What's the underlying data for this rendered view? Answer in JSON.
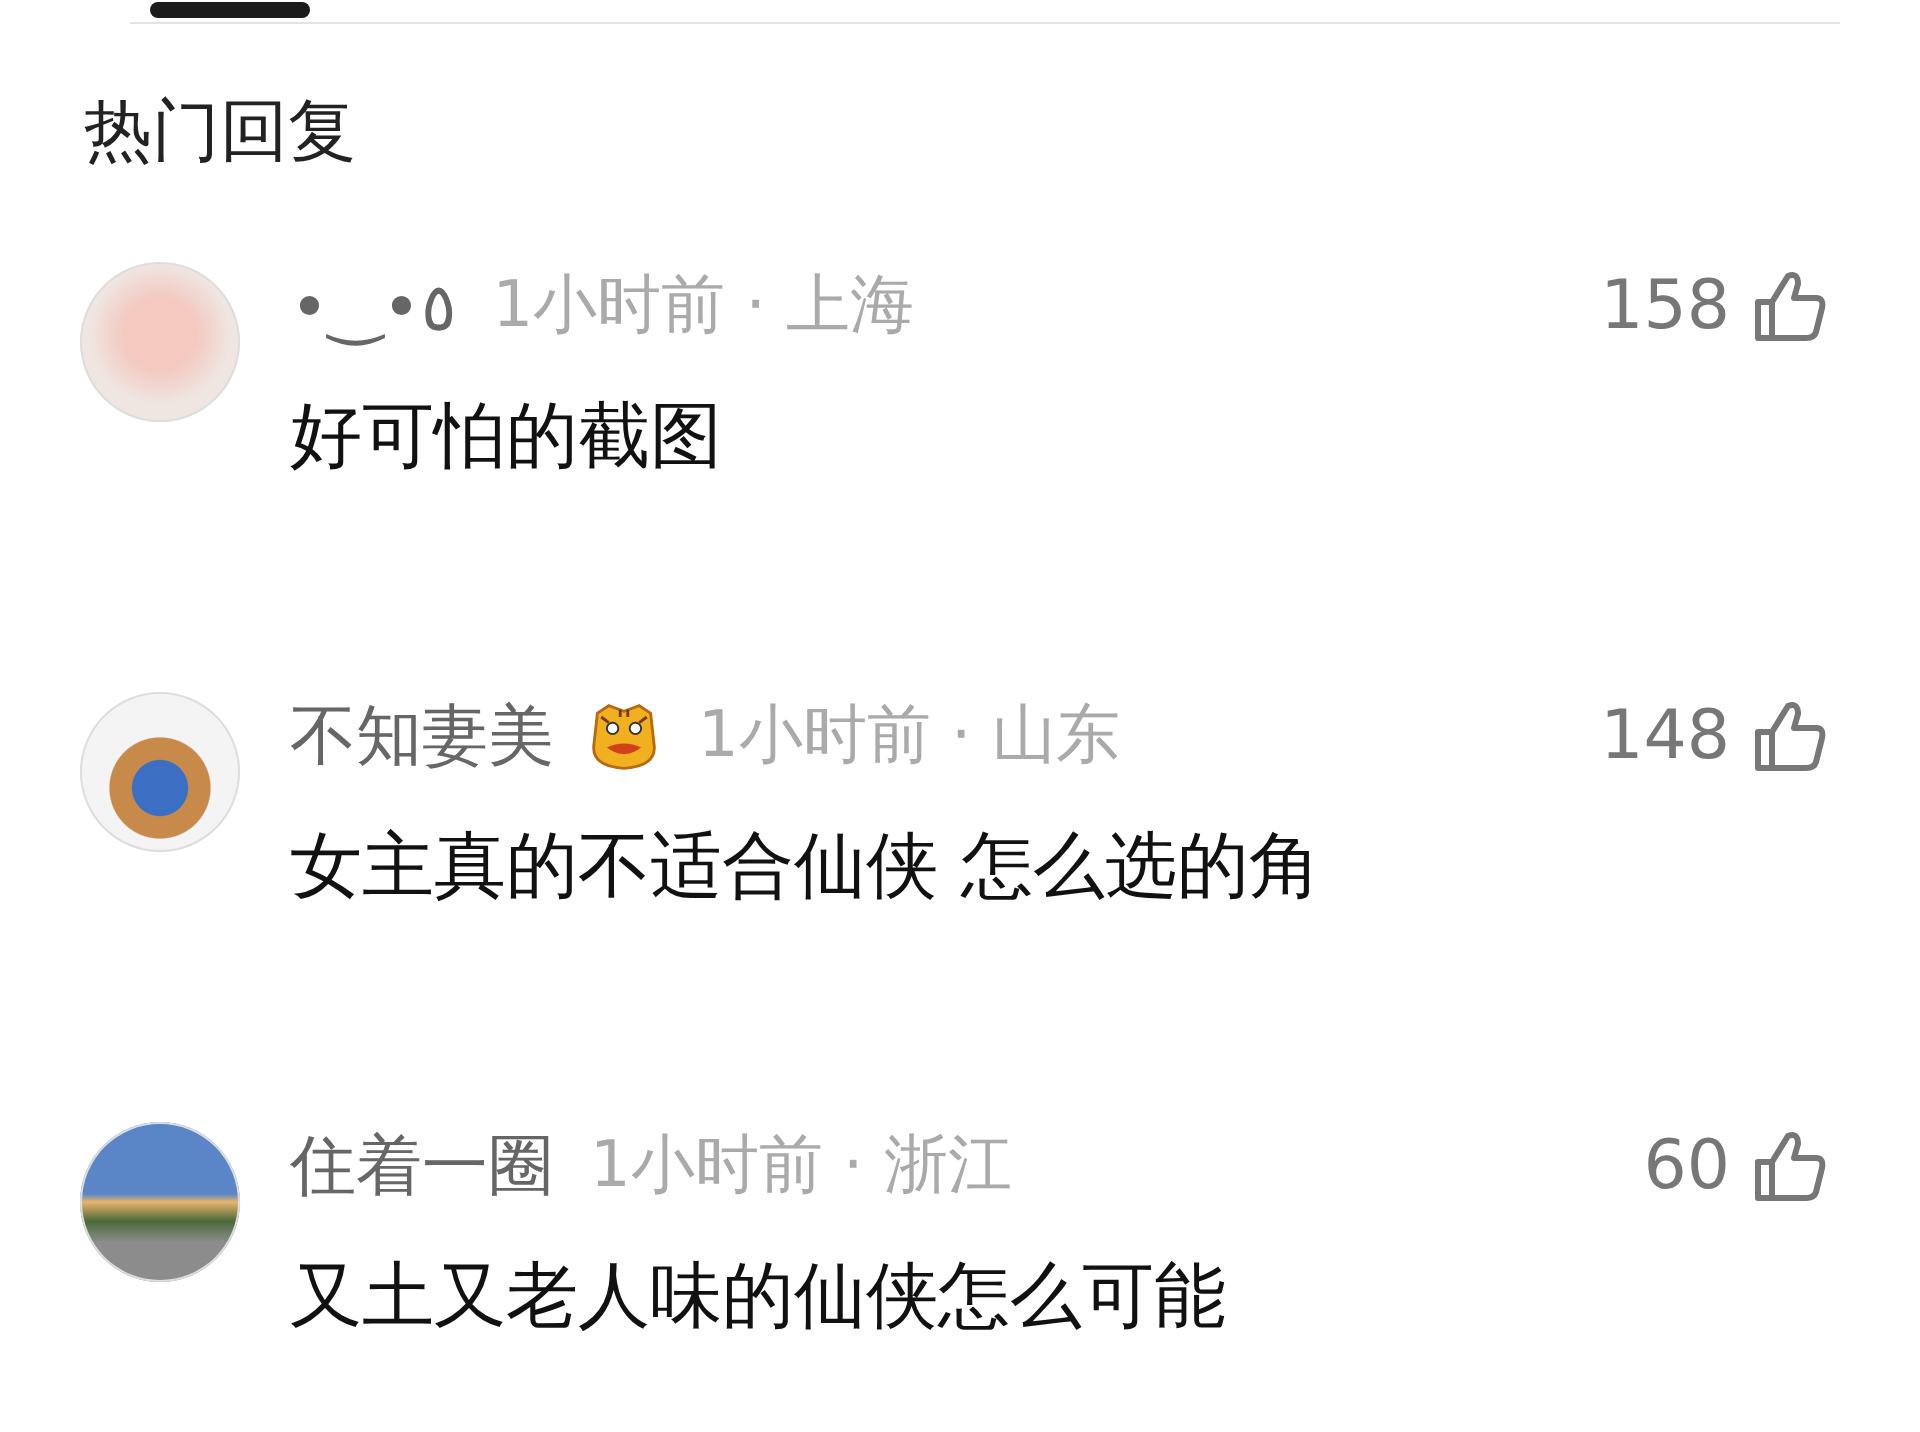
{
  "section_title": "热门回复",
  "comments": [
    {
      "name": "•‿•٥",
      "badge": false,
      "meta": "1小时前 · 上海",
      "likes": "158",
      "text": "好可怕的截图"
    },
    {
      "name": "不知妻美",
      "badge": true,
      "meta": "1小时前 · 山东",
      "likes": "148",
      "text": "女主真的不适合仙侠 怎么选的角"
    },
    {
      "name": "住着一圈",
      "badge": false,
      "meta": "1小时前 · 浙江",
      "likes": "60",
      "text": "又土又老人味的仙侠怎么可能"
    }
  ]
}
